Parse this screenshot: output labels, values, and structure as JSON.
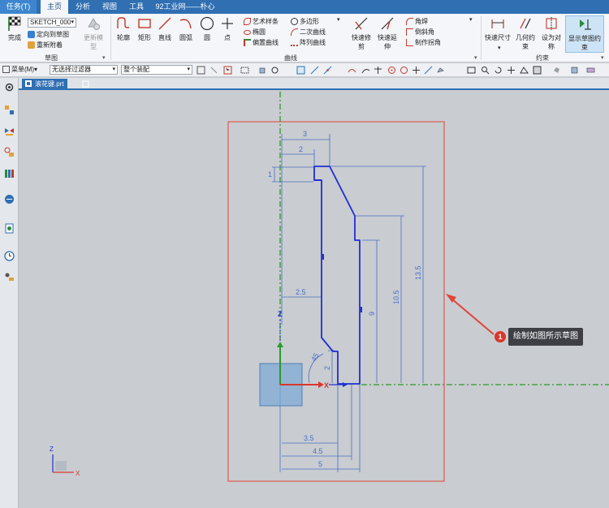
{
  "menu": {
    "tabs": [
      "任务(T)",
      "主页",
      "分析",
      "视图",
      "工具",
      "92工业网——朴心"
    ],
    "active": "主页"
  },
  "ribbon": {
    "sketch_group": {
      "finish_label": "完成",
      "sketch_name": "SKETCH_000",
      "orient_label": "定向到草图",
      "reattach_label": "重新附着",
      "update_model_label": "更新模型",
      "group_label": "草图"
    },
    "curve_group": {
      "profile": "轮廓",
      "rectangle": "矩形",
      "line": "直线",
      "arc": "圆弧",
      "circle": "圆",
      "point": "点",
      "studio_spline": "艺术样条",
      "ellipse": "椭圆",
      "offset_curve": "偏置曲线",
      "polygon": "多边形",
      "conic": "二次曲线",
      "pattern_curve": "阵列曲线",
      "quick_trim": "快速修剪",
      "quick_extend": "快速延伸",
      "fillet": "角焊",
      "chamfer": "倒斜角",
      "make_corner": "制作拐角",
      "group_label": "曲线"
    },
    "constraint_group": {
      "rapid_dimension": "快速尺寸",
      "geometric_constraint": "几何约束",
      "make_symmetric": "设为对称",
      "show_constraints": "显示草图约束",
      "group_label": "约束"
    }
  },
  "toolbar2": {
    "menu_label": "菜单(M)",
    "selection_filter": "无选择过滤器",
    "scope": "整个装配"
  },
  "file_tab": {
    "label": "滚花键.prt"
  },
  "sketch": {
    "dimensions": {
      "top_3": "3",
      "top_2": "2",
      "left_1": "1",
      "mid_2_5": "2.5",
      "right_13_5": "13.5",
      "right_10_5": "10.5",
      "right_9": "9",
      "small_2": "2",
      "angle_45": "45",
      "bottom_3_5": "3.5",
      "bottom_4_5": "4.5",
      "bottom_5": "5"
    },
    "axis_labels": {
      "z": "Z",
      "x": "X"
    }
  },
  "callout": {
    "badge": "1",
    "text": "绘制如图所示草图"
  },
  "colors": {
    "accent": "#2f6fb2",
    "sketch_blue": "#1f2fd0",
    "dim_blue": "#4a6fc8",
    "datum_green": "#2a9a2a",
    "annotation_red": "#e0453a"
  }
}
